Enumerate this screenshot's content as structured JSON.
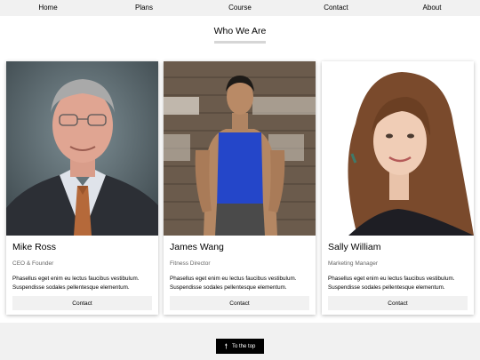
{
  "nav": {
    "items": [
      {
        "label": "Home"
      },
      {
        "label": "Plans"
      },
      {
        "label": "Course"
      },
      {
        "label": "Contact"
      },
      {
        "label": "About"
      }
    ]
  },
  "section": {
    "title": "Who We Are"
  },
  "team": [
    {
      "name": "Mike Ross",
      "role": "CEO & Founder",
      "description": "Phasellus eget enim eu lectus faucibus vestibulum. Suspendisse sodales pellentesque elementum.",
      "button": "Contact"
    },
    {
      "name": "James Wang",
      "role": "Fitness Director",
      "description": "Phasellus eget enim eu lectus faucibus vestibulum. Suspendisse sodales pellentesque elementum.",
      "button": "Contact"
    },
    {
      "name": "Sally William",
      "role": "Marketing Manager",
      "description": "Phasellus eget enim eu lectus faucibus vestibulum. Suspendisse sodales pellentesque elementum.",
      "button": "Contact"
    }
  ],
  "footer": {
    "to_top_label": "To the top",
    "to_top_icon": "arrow-up-icon"
  }
}
